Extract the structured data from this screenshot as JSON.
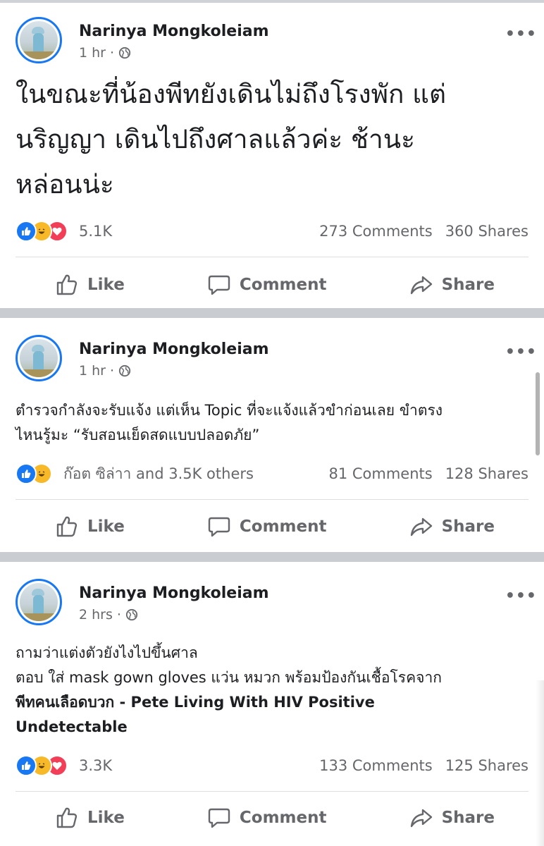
{
  "posts": [
    {
      "author": "Narinya Mongkoleiam",
      "time": "1 hr",
      "body": [
        "ในขณะที่น้องพีทยังเดินไม่ถึงโรงพัก แต่",
        "นริญญา เดินไปถึงศาลแล้วค่ะ ช้านะ",
        "หล่อนน่ะ"
      ],
      "reactions": [
        "like",
        "haha",
        "love"
      ],
      "reaction_count": "5.1K",
      "comments": "273 Comments",
      "shares": "360 Shares"
    },
    {
      "author": "Narinya Mongkoleiam",
      "time": "1 hr",
      "body": [
        "ตำรวจกำลังจะรับแจ้ง แต่เห็น Topic ที่จะแจ้งแล้วขำก่อนเลย ขำตรง",
        "ไหนรู้มะ “รับสอนเย็ดสดแบบปลอดภัย”"
      ],
      "reactions": [
        "like",
        "haha"
      ],
      "reaction_count": "ก๊อต ซิล่าา and 3.5K others",
      "comments": "81 Comments",
      "shares": "128 Shares"
    },
    {
      "author": "Narinya Mongkoleiam",
      "time": "2 hrs",
      "body": [
        "ถามว่าแต่งตัวยังไงไปขึ้นศาล",
        "ตอบ ใส่ mask gown gloves แว่น หมวก พร้อมป้องกันเชื้อโรคจาก"
      ],
      "body_bold": [
        "พีทคนเลือดบวก - Pete Living With HIV Positive",
        "Undetectable"
      ],
      "reactions": [
        "like",
        "haha",
        "love"
      ],
      "reaction_count": "3.3K",
      "comments": "133 Comments",
      "shares": "125 Shares"
    }
  ],
  "actions": {
    "like": "Like",
    "comment": "Comment",
    "share": "Share"
  },
  "more_label": "•••",
  "separator": "·",
  "icons": {
    "privacy": "globe-icon",
    "like": "thumbs-up-icon",
    "comment": "speech-bubble-icon",
    "share": "share-arrow-icon"
  },
  "colors": {
    "like_blue": "#1877f2",
    "haha_yellow": "#f7b928",
    "love_red": "#f33e58",
    "secondary_text": "#65676b",
    "feed_gap": "#c9ccd1"
  }
}
